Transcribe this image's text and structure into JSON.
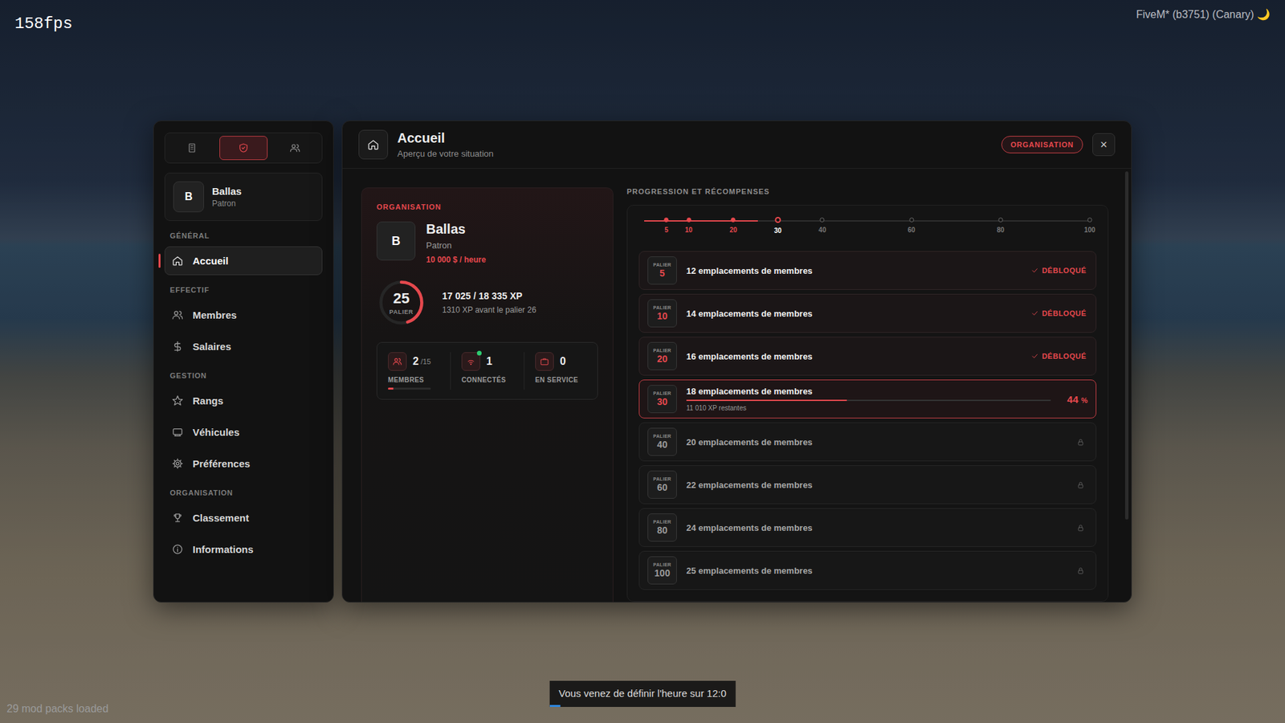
{
  "hud": {
    "fps": "158fps",
    "build": "FiveM* (b3751) (Canary)",
    "build_icon": "🌙",
    "mods": "29 mod packs loaded"
  },
  "notification": {
    "text": "Vous venez de définir l'heure sur 12:0",
    "level": 0.06
  },
  "sidebar": {
    "tabs": [
      {
        "kind": "building",
        "selected": false
      },
      {
        "kind": "shield",
        "selected": true
      },
      {
        "kind": "people",
        "selected": false
      }
    ],
    "profile": {
      "avatar": "B",
      "name": "Ballas",
      "role": "Patron"
    },
    "sections": [
      {
        "title": "GÉNÉRAL",
        "items": [
          {
            "label": "Accueil",
            "kind": "home",
            "selected": true
          }
        ]
      },
      {
        "title": "EFFECTIF",
        "items": [
          {
            "label": "Membres",
            "kind": "users",
            "selected": false
          },
          {
            "label": "Salaires",
            "kind": "dollar",
            "selected": false
          }
        ]
      },
      {
        "title": "GESTION",
        "items": [
          {
            "label": "Rangs",
            "kind": "star",
            "selected": false
          },
          {
            "label": "Véhicules",
            "kind": "vehicle",
            "selected": false
          },
          {
            "label": "Préférences",
            "kind": "gear",
            "selected": false
          }
        ]
      },
      {
        "title": "ORGANISATION",
        "items": [
          {
            "label": "Classement",
            "kind": "trophy",
            "selected": false
          },
          {
            "label": "Informations",
            "kind": "info",
            "selected": false
          }
        ]
      }
    ]
  },
  "header": {
    "title": "Accueil",
    "subtitle": "Aperçu de votre situation",
    "badge": "ORGANISATION",
    "close": "×"
  },
  "org_card": {
    "label": "ORGANISATION",
    "avatar": "B",
    "name": "Ballas",
    "role": "Patron",
    "income": "10 000 $ / heure",
    "tier": "25",
    "tier_label": "PALIER",
    "tier_level": 0.45,
    "xp": "17 025 / 18 335 XP",
    "xp_note": "1310 XP avant le palier 26",
    "stats": [
      {
        "kind": "members",
        "value": "2",
        "max": "/15",
        "label": "MEMBRES",
        "level": 0.13
      },
      {
        "kind": "connected",
        "value": "1",
        "max": "",
        "label": "CONNECTÉS",
        "level": 0
      },
      {
        "kind": "service",
        "value": "0",
        "max": "",
        "label": "EN SERVICE",
        "level": 0
      }
    ]
  },
  "progression": {
    "title": "PROGRESSION ET RÉCOMPENSES",
    "timeline": {
      "level": 0.255,
      "points": [
        {
          "label": "5",
          "reached": true,
          "selected": false
        },
        {
          "label": "10",
          "reached": true,
          "selected": false
        },
        {
          "label": "20",
          "reached": true,
          "selected": false
        },
        {
          "label": "30",
          "reached": false,
          "selected": true
        },
        {
          "label": "40",
          "reached": false,
          "selected": false
        },
        {
          "label": "60",
          "reached": false,
          "selected": false
        },
        {
          "label": "80",
          "reached": false,
          "selected": false
        },
        {
          "label": "100",
          "reached": false,
          "selected": false
        }
      ]
    },
    "rows": [
      {
        "tier_label": "PALIER",
        "tier": "5",
        "text": "12 emplacements de membres",
        "kind": "unlocked",
        "status": "DÉBLOQUÉ"
      },
      {
        "tier_label": "PALIER",
        "tier": "10",
        "text": "14 emplacements de membres",
        "kind": "unlocked",
        "status": "DÉBLOQUÉ"
      },
      {
        "tier_label": "PALIER",
        "tier": "20",
        "text": "16 emplacements de membres",
        "kind": "unlocked",
        "status": "DÉBLOQUÉ"
      },
      {
        "tier_label": "PALIER",
        "tier": "30",
        "text": "18 emplacements de membres",
        "kind": "current",
        "level": 0.44,
        "percent": "44",
        "percent_sign": "%",
        "remaining": "11 010 XP restantes"
      },
      {
        "tier_label": "PALIER",
        "tier": "40",
        "text": "20 emplacements de membres",
        "kind": "locked"
      },
      {
        "tier_label": "PALIER",
        "tier": "60",
        "text": "22 emplacements de membres",
        "kind": "locked"
      },
      {
        "tier_label": "PALIER",
        "tier": "80",
        "text": "24 emplacements de membres",
        "kind": "locked"
      },
      {
        "tier_label": "PALIER",
        "tier": "100",
        "text": "25 emplacements de membres",
        "kind": "locked"
      }
    ]
  }
}
